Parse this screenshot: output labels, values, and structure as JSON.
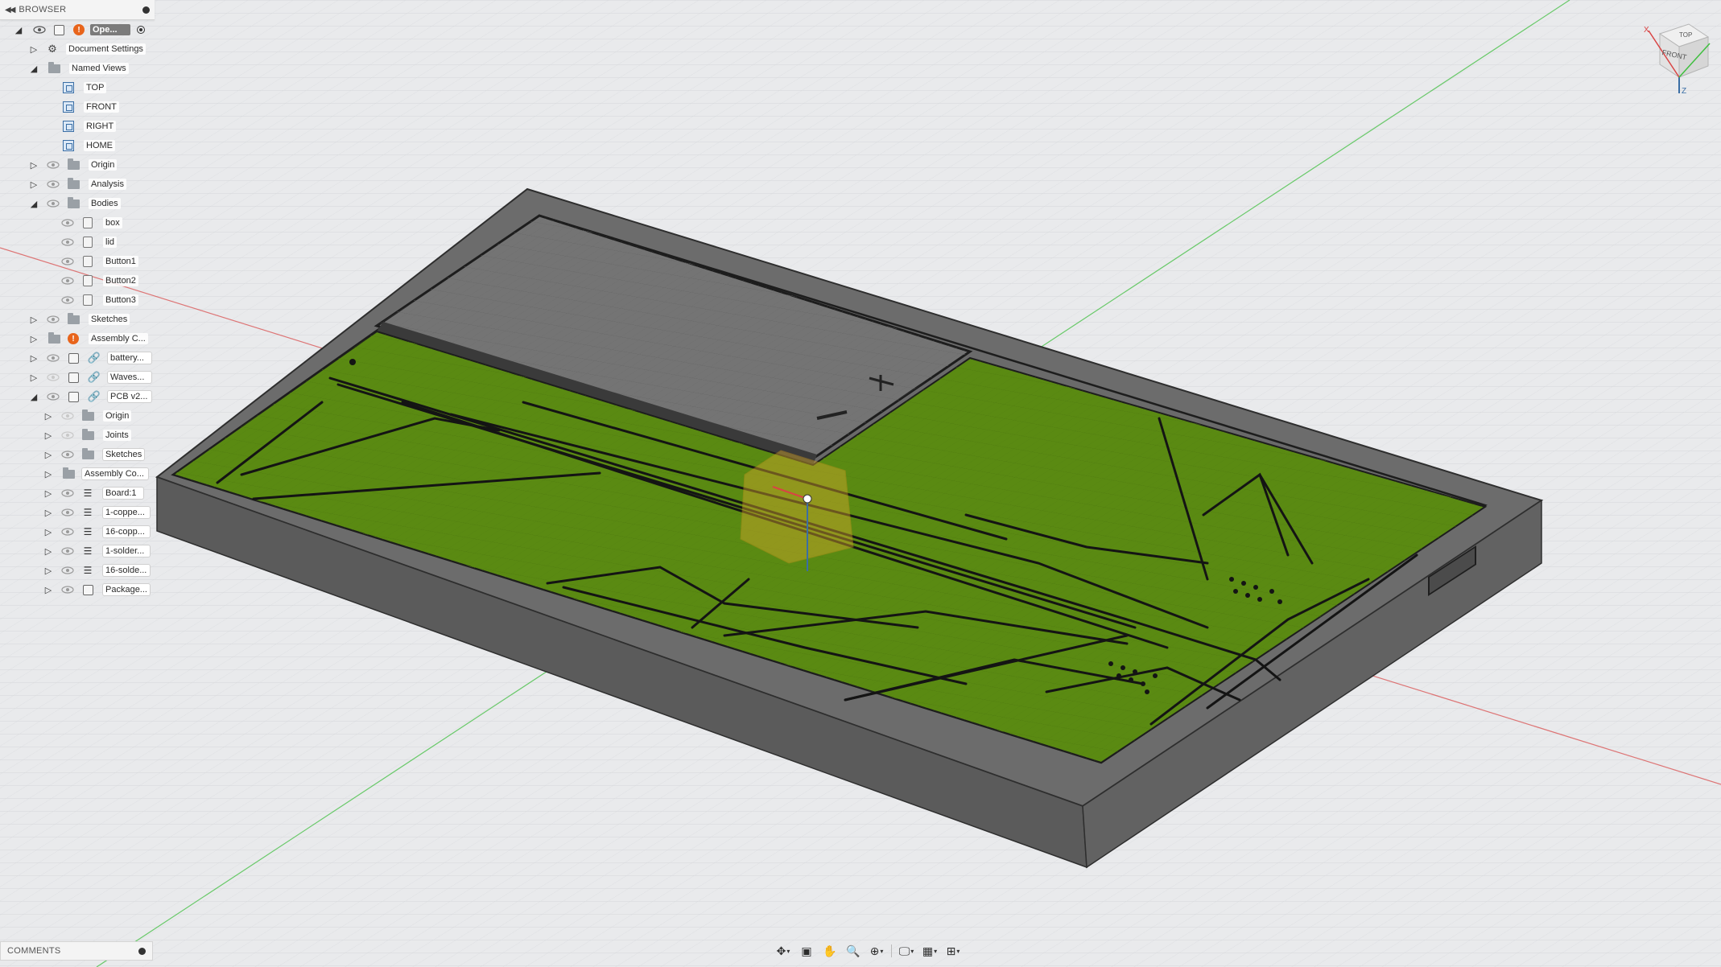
{
  "browser": {
    "title": "BROWSER",
    "root_label": "Ope...",
    "rows": [
      {
        "label": "Document Settings"
      },
      {
        "label": "Named Views"
      },
      {
        "label": "TOP"
      },
      {
        "label": "FRONT"
      },
      {
        "label": "RIGHT"
      },
      {
        "label": "HOME"
      },
      {
        "label": "Origin"
      },
      {
        "label": "Analysis"
      },
      {
        "label": "Bodies"
      },
      {
        "label": "box"
      },
      {
        "label": "lid"
      },
      {
        "label": "Button1"
      },
      {
        "label": "Button2"
      },
      {
        "label": "Button3"
      },
      {
        "label": "Sketches"
      },
      {
        "label": "Assembly C..."
      },
      {
        "label": "battery..."
      },
      {
        "label": "Waves..."
      },
      {
        "label": "PCB v2..."
      },
      {
        "label": "Origin"
      },
      {
        "label": "Joints"
      },
      {
        "label": "Sketches"
      },
      {
        "label": "Assembly Co..."
      },
      {
        "label": "Board:1"
      },
      {
        "label": "1-coppe..."
      },
      {
        "label": "16-copp..."
      },
      {
        "label": "1-solder..."
      },
      {
        "label": "16-solde..."
      },
      {
        "label": "Package..."
      }
    ]
  },
  "comments": {
    "title": "COMMENTS"
  },
  "viewcube": {
    "top_label": "TOP",
    "front_label": "FRONT",
    "x_axis": "X",
    "z_axis": "Z"
  },
  "navbar": {
    "icons": [
      "orbit-icon",
      "look-at-icon",
      "pan-icon",
      "zoom-icon",
      "fit-icon",
      "display-settings-icon",
      "grid-icon",
      "viewports-icon"
    ]
  },
  "colors": {
    "background": "#e9eaec",
    "grid_line": "#d2d4d7",
    "enclosure": "#6f6f6f",
    "enclosure_wall": "#5d5d5d",
    "pcb_green": "#5a8a12",
    "trace": "#141414",
    "axis_red": "#d94444",
    "axis_green": "#3fbf3f",
    "warning": "#e8641b"
  }
}
